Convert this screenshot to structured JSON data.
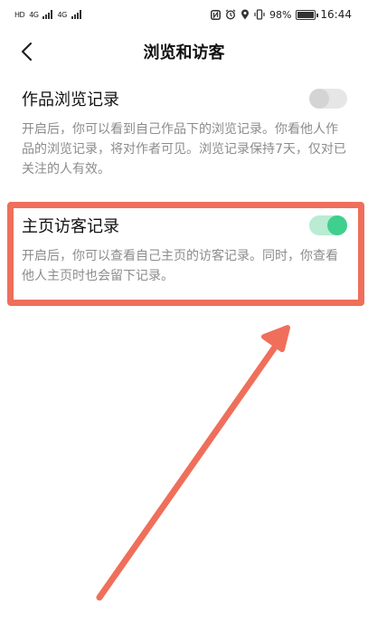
{
  "status_bar": {
    "left_text": "HD",
    "net1": "4G",
    "net2": "4G",
    "battery": "98%",
    "time": "16:44"
  },
  "header": {
    "title": "浏览和访客"
  },
  "settings": [
    {
      "title": "作品浏览记录",
      "description": "开启后，你可以看到自己作品下的浏览记录。你看他人作品的浏览记录，将对作者可见。浏览记录保持7天，仅对已关注的人有效。",
      "enabled": false
    },
    {
      "title": "主页访客记录",
      "description": "开启后，你可以查看自己主页的访客记录。同时，你查看他人主页时也会留下记录。",
      "enabled": true
    }
  ],
  "colors": {
    "toggle_on": "#3fcf8e",
    "highlight": "#ef6f5b"
  }
}
